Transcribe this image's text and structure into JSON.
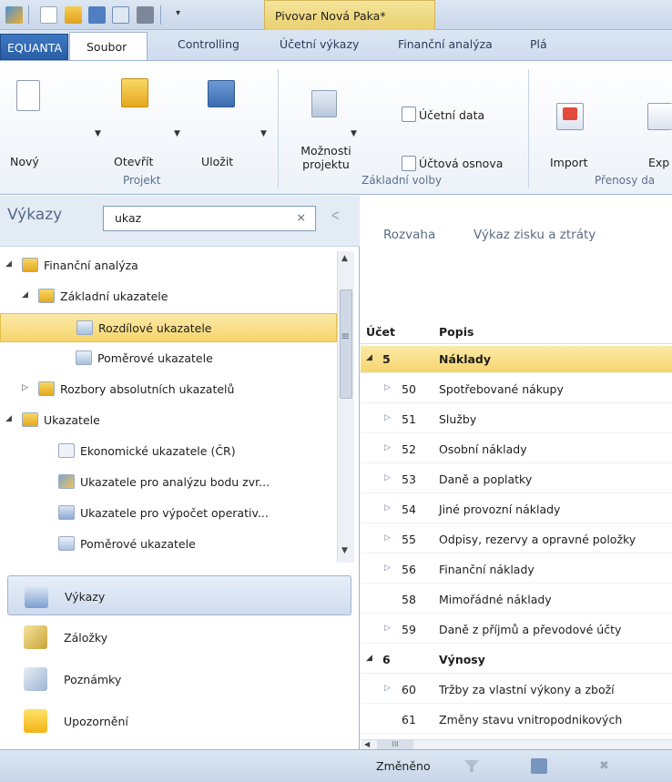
{
  "titlebar": {
    "document_title": "Pivovar Nová Paka*"
  },
  "menu": {
    "tabs": [
      "EQUANTA",
      "Soubor",
      "Controlling",
      "Účetní výkazy",
      "Finanční analýza",
      "Plá"
    ]
  },
  "ribbon": {
    "buttons": {
      "new": "Nový",
      "open": "Otevřít",
      "save": "Uložit",
      "options_l1": "Možnosti",
      "options_l2": "projektu",
      "accounting_data": "Účetní data",
      "chart_of_accounts": "Účtová osnova",
      "import": "Import",
      "export": "Exp"
    },
    "groups": {
      "project": "Projekt",
      "basic": "Základní volby",
      "transfer": "Přenosy da"
    }
  },
  "left": {
    "header": "Výkazy",
    "search_value": "ukaz",
    "search_clear": "×",
    "collapse": "ᐸ",
    "tree": [
      {
        "label": "Finanční analýza",
        "level": 0,
        "expanded": true,
        "icon": "folder-icon"
      },
      {
        "label": "Základní ukazatele",
        "level": 1,
        "expanded": true,
        "icon": "folder-icon"
      },
      {
        "label": "Rozdílové ukazatele",
        "level": 2,
        "selected": true,
        "icon": "report-icon"
      },
      {
        "label": "Poměrové ukazatele",
        "level": 2,
        "icon": "report-icon"
      },
      {
        "label": "Rozbory absolutních ukazatelů",
        "level": 1,
        "expanded": false,
        "icon": "folder-icon"
      },
      {
        "label": "Ukazatele",
        "level": 0,
        "expanded": true,
        "icon": "folder-icon"
      },
      {
        "label": "Ekonomické ukazatele (ČR)",
        "level": 1,
        "icon": "formula-icon"
      },
      {
        "label": "Ukazatele pro analýzu bodu zvr...",
        "level": 1,
        "icon": "chart-icon"
      },
      {
        "label": "Ukazatele pro výpočet operativ...",
        "level": 1,
        "icon": "table-icon"
      },
      {
        "label": "Poměrové ukazatele",
        "level": 1,
        "icon": "report-icon"
      }
    ],
    "nav": [
      "Výkazy",
      "Záložky",
      "Poznámky",
      "Upozornění"
    ]
  },
  "right": {
    "tabs": [
      "Rozvaha",
      "Výkaz zisku a ztráty"
    ],
    "columns": {
      "account": "Účet",
      "description": "Popis"
    },
    "rows": [
      {
        "account": "5",
        "description": "Náklady",
        "group": true,
        "selected": true
      },
      {
        "account": "50",
        "description": "Spotřebované nákupy"
      },
      {
        "account": "51",
        "description": "Služby"
      },
      {
        "account": "52",
        "description": "Osobní náklady"
      },
      {
        "account": "53",
        "description": "Daně a poplatky"
      },
      {
        "account": "54",
        "description": "Jiné provozní náklady"
      },
      {
        "account": "55",
        "description": "Odpisy, rezervy a opravné položky"
      },
      {
        "account": "56",
        "description": "Finanční náklady"
      },
      {
        "account": "58",
        "description": "Mimořádné náklady",
        "leaf": true
      },
      {
        "account": "59",
        "description": "Daně z příjmů a převodové účty"
      },
      {
        "account": "6",
        "description": "Výnosy",
        "group": true
      },
      {
        "account": "60",
        "description": "Tržby za vlastní výkony a zboží"
      },
      {
        "account": "61",
        "description": "Změny stavu vnitropodnikových",
        "leaf": true
      }
    ],
    "hscroll": "III"
  },
  "status": {
    "changed": "Změněno"
  }
}
